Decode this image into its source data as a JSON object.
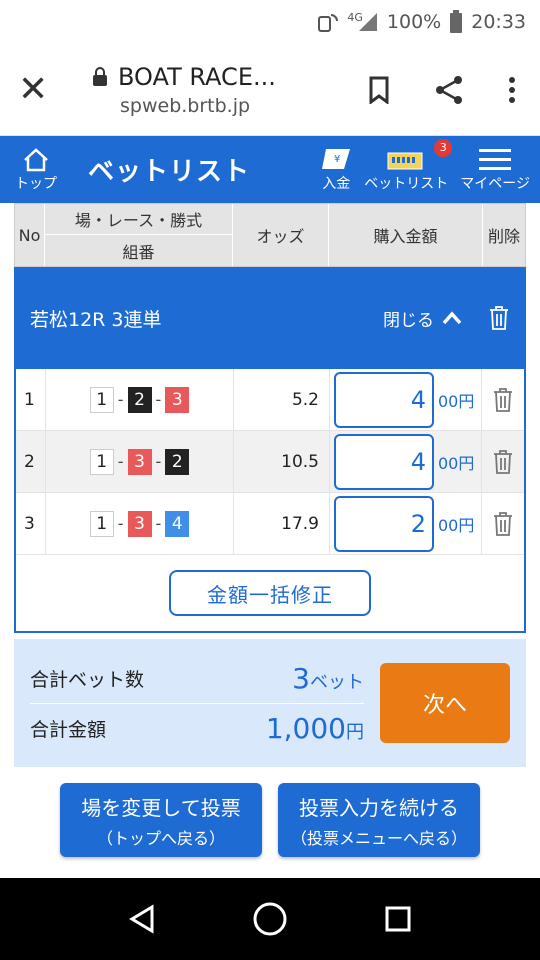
{
  "status_bar": {
    "network": "4G",
    "battery": "100%",
    "time": "20:33"
  },
  "browser": {
    "title": "BOAT RACE...",
    "url": "spweb.brtb.jp"
  },
  "header": {
    "home_label": "トップ",
    "title": "ベットリスト",
    "nav": [
      {
        "label": "入金",
        "icon": "deposit-icon"
      },
      {
        "label": "ベットリスト",
        "icon": "betlist-icon",
        "badge": "3"
      },
      {
        "label": "マイページ",
        "icon": "menu-icon"
      }
    ]
  },
  "table_header": {
    "no": "No",
    "race_top": "場・レース・勝式",
    "race_bottom": "組番",
    "odds": "オッズ",
    "amount": "購入金額",
    "delete": "削除"
  },
  "race": {
    "name": "若松12R 3連単",
    "close_label": "閉じる"
  },
  "bets": [
    {
      "no": "1",
      "combo": [
        "1",
        "2",
        "3"
      ],
      "odds": "5.2",
      "amount": "4",
      "unit": "00円"
    },
    {
      "no": "2",
      "combo": [
        "1",
        "3",
        "2"
      ],
      "odds": "10.5",
      "amount": "4",
      "unit": "00円"
    },
    {
      "no": "3",
      "combo": [
        "1",
        "3",
        "4"
      ],
      "odds": "17.9",
      "amount": "2",
      "unit": "00円"
    }
  ],
  "bulk_edit_label": "金額一括修正",
  "summary": {
    "count_label": "合計ベット数",
    "count_value": "3",
    "count_unit": "ベット",
    "total_label": "合計金額",
    "total_value": "1,000",
    "total_unit": "円",
    "next_label": "次へ"
  },
  "bottom_buttons": [
    {
      "main": "場を変更して投票",
      "sub": "（トップへ戻る）"
    },
    {
      "main": "投票入力を続ける",
      "sub": "（投票メニューへ戻る）"
    }
  ],
  "colors": {
    "primary": "#1e6bd4",
    "accent": "#ea7b14",
    "summary_bg": "#d9e8fa"
  }
}
